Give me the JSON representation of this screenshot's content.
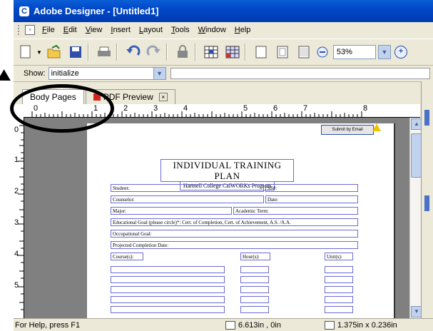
{
  "window": {
    "title": "Adobe Designer - [Untitled1]"
  },
  "menu": {
    "items": [
      {
        "underline": "F",
        "rest": "ile"
      },
      {
        "underline": "E",
        "rest": "dit"
      },
      {
        "underline": "V",
        "rest": "iew"
      },
      {
        "underline": "I",
        "rest": "nsert"
      },
      {
        "underline": "L",
        "rest": "ayout"
      },
      {
        "underline": "T",
        "rest": "ools"
      },
      {
        "underline": "W",
        "rest": "indow"
      },
      {
        "underline": "H",
        "rest": "elp"
      }
    ]
  },
  "toolbar": {
    "zoom_value": "53%"
  },
  "showbar": {
    "label": "Show:",
    "value": "initialize"
  },
  "tabs": {
    "body_pages": "Body Pages",
    "pdf_preview": "PDF Preview"
  },
  "ruler": {
    "top": [
      "0",
      "1",
      "2",
      "3",
      "4",
      "5",
      "6",
      "7",
      "8"
    ],
    "left": [
      "0",
      "1",
      "2",
      "3",
      "4",
      "5"
    ]
  },
  "form": {
    "submit_label": "Submit by Email",
    "title": "INDIVIDUAL TRAINING PLAN",
    "subtitle": "Hartnell College CalWORKs Program",
    "student": "Student:",
    "ssn": "SS#:",
    "counselor": "Counselor:",
    "date": "Date:",
    "major": "Major:",
    "academic_term": "Academic Term:",
    "educational_goal": "Educational Goal (please circle)*: Cert. of Completion, Cert. of Achievement, A.S. /A.A.",
    "occupational_goal": "Occupational Goal:",
    "projected_completion": "Projected Completion Date:",
    "courses": "Course(s):",
    "hours": "Hour(s):",
    "units": "Unit(s):"
  },
  "status": {
    "help": "For Help, press F1",
    "position": "6.613in , 0in",
    "size": "1.375in x 0.236in"
  }
}
